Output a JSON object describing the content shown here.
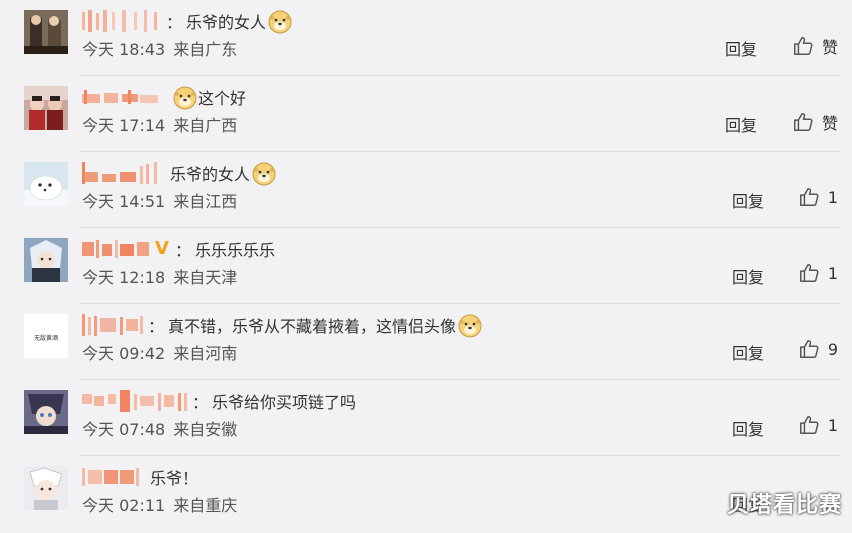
{
  "comments": [
    {
      "colon": "：",
      "text": "乐爷的女人",
      "emoji": true,
      "v": false,
      "time": "今天 18:43",
      "location": "来自广东",
      "reply": "回复",
      "likes": "赞"
    },
    {
      "colon": "",
      "text": "这个好",
      "emoji_before": true,
      "v": false,
      "time": "今天 17:14",
      "location": "来自广西",
      "reply": "回复",
      "likes": "赞"
    },
    {
      "colon": "",
      "text": "乐爷的女人",
      "emoji": true,
      "v": false,
      "time": "今天 14:51",
      "location": "来自江西",
      "reply": "回复",
      "likes": "1"
    },
    {
      "colon": "：",
      "text": "乐乐乐乐乐",
      "emoji": false,
      "v": true,
      "time": "今天 12:18",
      "location": "来自天津",
      "reply": "回复",
      "likes": "1"
    },
    {
      "colon": "：",
      "text": "真不错，乐爷从不藏着掖着，这情侣头像",
      "emoji": true,
      "v": false,
      "time": "今天 09:42",
      "location": "来自河南",
      "reply": "回复",
      "likes": "9"
    },
    {
      "colon": "：",
      "text": "乐爷给你买项链了吗",
      "emoji": false,
      "v": false,
      "time": "今天 07:48",
      "location": "来自安徽",
      "reply": "回复",
      "likes": "1"
    },
    {
      "colon": "",
      "text": "乐爷！",
      "emoji": false,
      "v": false,
      "time": "今天 02:11",
      "location": "来自重庆",
      "reply": "回复",
      "likes": ""
    }
  ],
  "watermark": "贝塔看比赛",
  "avatar_texts": {
    "a5": "无敌黄酒"
  },
  "colors": {
    "background": "#f2f2f5",
    "divider": "#dcdcdf",
    "redacted_name": "#f0855f",
    "verified": "#f3a01c"
  },
  "icons": {
    "like": "thumbs-up-icon",
    "emoji": "doge-emoji-icon",
    "verified": "verified-v-icon"
  }
}
